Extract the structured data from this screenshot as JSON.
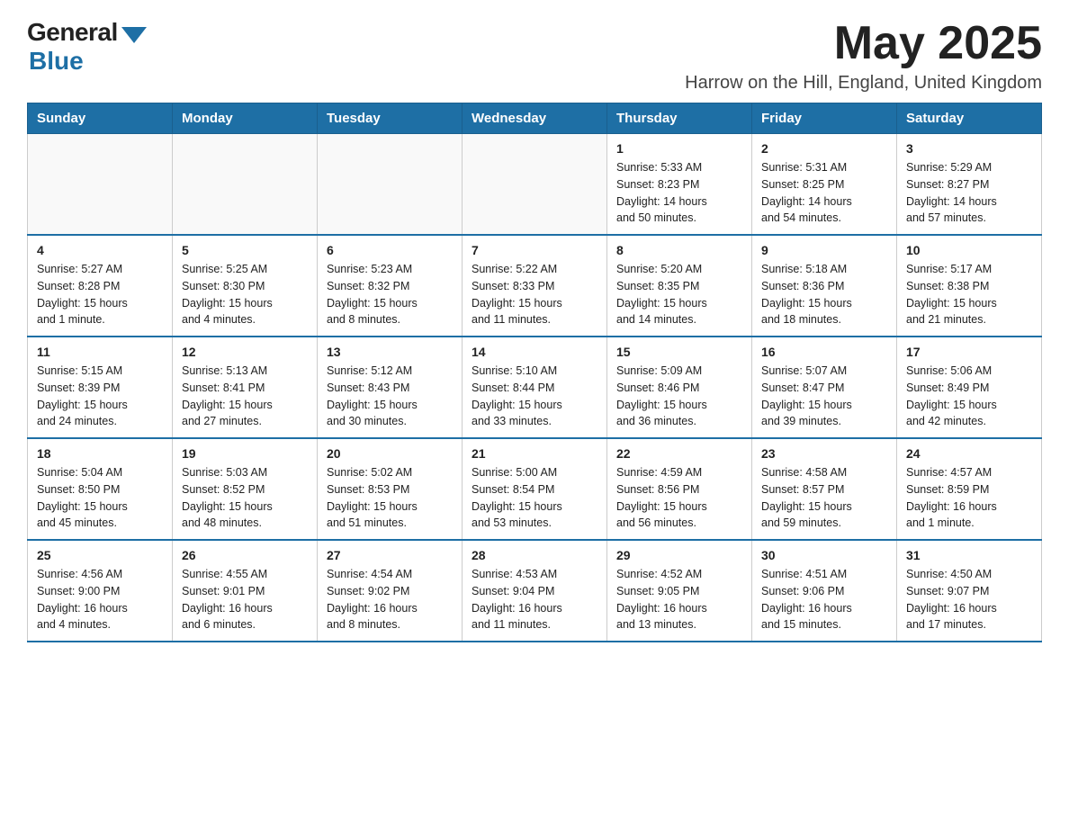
{
  "header": {
    "logo_general": "General",
    "logo_blue": "Blue",
    "month_title": "May 2025",
    "subtitle": "Harrow on the Hill, England, United Kingdom"
  },
  "calendar": {
    "days_of_week": [
      "Sunday",
      "Monday",
      "Tuesday",
      "Wednesday",
      "Thursday",
      "Friday",
      "Saturday"
    ],
    "weeks": [
      [
        {
          "day": "",
          "info": ""
        },
        {
          "day": "",
          "info": ""
        },
        {
          "day": "",
          "info": ""
        },
        {
          "day": "",
          "info": ""
        },
        {
          "day": "1",
          "info": "Sunrise: 5:33 AM\nSunset: 8:23 PM\nDaylight: 14 hours\nand 50 minutes."
        },
        {
          "day": "2",
          "info": "Sunrise: 5:31 AM\nSunset: 8:25 PM\nDaylight: 14 hours\nand 54 minutes."
        },
        {
          "day": "3",
          "info": "Sunrise: 5:29 AM\nSunset: 8:27 PM\nDaylight: 14 hours\nand 57 minutes."
        }
      ],
      [
        {
          "day": "4",
          "info": "Sunrise: 5:27 AM\nSunset: 8:28 PM\nDaylight: 15 hours\nand 1 minute."
        },
        {
          "day": "5",
          "info": "Sunrise: 5:25 AM\nSunset: 8:30 PM\nDaylight: 15 hours\nand 4 minutes."
        },
        {
          "day": "6",
          "info": "Sunrise: 5:23 AM\nSunset: 8:32 PM\nDaylight: 15 hours\nand 8 minutes."
        },
        {
          "day": "7",
          "info": "Sunrise: 5:22 AM\nSunset: 8:33 PM\nDaylight: 15 hours\nand 11 minutes."
        },
        {
          "day": "8",
          "info": "Sunrise: 5:20 AM\nSunset: 8:35 PM\nDaylight: 15 hours\nand 14 minutes."
        },
        {
          "day": "9",
          "info": "Sunrise: 5:18 AM\nSunset: 8:36 PM\nDaylight: 15 hours\nand 18 minutes."
        },
        {
          "day": "10",
          "info": "Sunrise: 5:17 AM\nSunset: 8:38 PM\nDaylight: 15 hours\nand 21 minutes."
        }
      ],
      [
        {
          "day": "11",
          "info": "Sunrise: 5:15 AM\nSunset: 8:39 PM\nDaylight: 15 hours\nand 24 minutes."
        },
        {
          "day": "12",
          "info": "Sunrise: 5:13 AM\nSunset: 8:41 PM\nDaylight: 15 hours\nand 27 minutes."
        },
        {
          "day": "13",
          "info": "Sunrise: 5:12 AM\nSunset: 8:43 PM\nDaylight: 15 hours\nand 30 minutes."
        },
        {
          "day": "14",
          "info": "Sunrise: 5:10 AM\nSunset: 8:44 PM\nDaylight: 15 hours\nand 33 minutes."
        },
        {
          "day": "15",
          "info": "Sunrise: 5:09 AM\nSunset: 8:46 PM\nDaylight: 15 hours\nand 36 minutes."
        },
        {
          "day": "16",
          "info": "Sunrise: 5:07 AM\nSunset: 8:47 PM\nDaylight: 15 hours\nand 39 minutes."
        },
        {
          "day": "17",
          "info": "Sunrise: 5:06 AM\nSunset: 8:49 PM\nDaylight: 15 hours\nand 42 minutes."
        }
      ],
      [
        {
          "day": "18",
          "info": "Sunrise: 5:04 AM\nSunset: 8:50 PM\nDaylight: 15 hours\nand 45 minutes."
        },
        {
          "day": "19",
          "info": "Sunrise: 5:03 AM\nSunset: 8:52 PM\nDaylight: 15 hours\nand 48 minutes."
        },
        {
          "day": "20",
          "info": "Sunrise: 5:02 AM\nSunset: 8:53 PM\nDaylight: 15 hours\nand 51 minutes."
        },
        {
          "day": "21",
          "info": "Sunrise: 5:00 AM\nSunset: 8:54 PM\nDaylight: 15 hours\nand 53 minutes."
        },
        {
          "day": "22",
          "info": "Sunrise: 4:59 AM\nSunset: 8:56 PM\nDaylight: 15 hours\nand 56 minutes."
        },
        {
          "day": "23",
          "info": "Sunrise: 4:58 AM\nSunset: 8:57 PM\nDaylight: 15 hours\nand 59 minutes."
        },
        {
          "day": "24",
          "info": "Sunrise: 4:57 AM\nSunset: 8:59 PM\nDaylight: 16 hours\nand 1 minute."
        }
      ],
      [
        {
          "day": "25",
          "info": "Sunrise: 4:56 AM\nSunset: 9:00 PM\nDaylight: 16 hours\nand 4 minutes."
        },
        {
          "day": "26",
          "info": "Sunrise: 4:55 AM\nSunset: 9:01 PM\nDaylight: 16 hours\nand 6 minutes."
        },
        {
          "day": "27",
          "info": "Sunrise: 4:54 AM\nSunset: 9:02 PM\nDaylight: 16 hours\nand 8 minutes."
        },
        {
          "day": "28",
          "info": "Sunrise: 4:53 AM\nSunset: 9:04 PM\nDaylight: 16 hours\nand 11 minutes."
        },
        {
          "day": "29",
          "info": "Sunrise: 4:52 AM\nSunset: 9:05 PM\nDaylight: 16 hours\nand 13 minutes."
        },
        {
          "day": "30",
          "info": "Sunrise: 4:51 AM\nSunset: 9:06 PM\nDaylight: 16 hours\nand 15 minutes."
        },
        {
          "day": "31",
          "info": "Sunrise: 4:50 AM\nSunset: 9:07 PM\nDaylight: 16 hours\nand 17 minutes."
        }
      ]
    ]
  }
}
